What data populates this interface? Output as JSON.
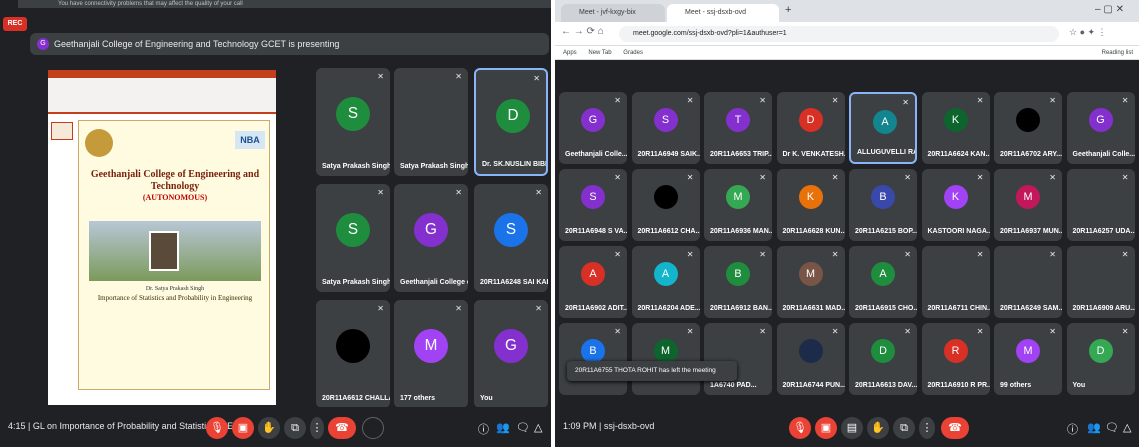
{
  "left": {
    "banner": "You have connectivity problems that may affect the quality of your call",
    "rec": "REC",
    "presenting_badge": "G",
    "presenting_text": "Geethanjali College of Engineering and Technology GCET is presenting",
    "slide": {
      "title": "Geethanjali College of Engineering and Technology",
      "autonomous": "(AUTONOMOUS)",
      "logo_right": "NBA",
      "presenter_name": "Dr. Satya Prakash Singh",
      "topic": "Importance of Statistics and Probability in Engineering"
    },
    "tiles": [
      {
        "initial": "S",
        "name": "Satya Prakash Singh",
        "color": "#1e8e3e"
      },
      {
        "initial": "",
        "name": "Satya Prakash Singh",
        "color": "#3c4043"
      },
      {
        "initial": "D",
        "name": "Dr. SK.NUSLIN BIBI GCET",
        "color": "#1e8e3e"
      },
      {
        "initial": "S",
        "name": "Satya Prakash Singh",
        "color": "#1e8e3e"
      },
      {
        "initial": "G",
        "name": "Geethanjali College of En...",
        "color": "#8430ce"
      },
      {
        "initial": "S",
        "name": "20R11A6248 SAI KARTHIK ...",
        "color": "#1a73e8"
      },
      {
        "initial": "",
        "name": "20R11A6612 CHALLA SHU...",
        "color": "#000000"
      },
      {
        "initial": "M",
        "name": "177 others",
        "color": "#a142f4"
      },
      {
        "initial": "G",
        "name": "You",
        "color": "#8430ce"
      }
    ],
    "bottom_text": "4:15 | GL on Importance of Probability and Statistics in En..."
  },
  "right": {
    "tabs": [
      "Meet - jvf-kxgy-bix",
      "Meet - ssj-dsxb-ovd"
    ],
    "url": "meet.google.com/ssj-dsxb-ovd?pli=1&authuser=1",
    "bookmarks": [
      "Apps",
      "New Tab",
      "Grades"
    ],
    "reading_list": "Reading list",
    "tiles": [
      {
        "initial": "G",
        "name": "Geethanjali Colle...",
        "color": "#8430ce"
      },
      {
        "initial": "S",
        "name": "20R11A6949 SAIK...",
        "color": "#8430ce"
      },
      {
        "initial": "T",
        "name": "20R11A6653 TRIP...",
        "color": "#8430ce"
      },
      {
        "initial": "D",
        "name": "Dr K. VENKATESH...",
        "color": "#d93025"
      },
      {
        "initial": "A",
        "name": "ALLUGUVELLI RA...",
        "color": "#12858f"
      },
      {
        "initial": "K",
        "name": "20R11A6624 KAN...",
        "color": "#0d652d"
      },
      {
        "initial": "",
        "name": "20R11A6702 ARY...",
        "color": "#000000"
      },
      {
        "initial": "G",
        "name": "Geethanjali Colle...",
        "color": "#8430ce"
      },
      {
        "initial": "S",
        "name": "20R11A6948 S VA...",
        "color": "#8430ce"
      },
      {
        "initial": "",
        "name": "20R11A6612 CHA...",
        "color": "#000000"
      },
      {
        "initial": "M",
        "name": "20R11A6936 MAN...",
        "color": "#34a853"
      },
      {
        "initial": "K",
        "name": "20R11A6628 KUN...",
        "color": "#e8710a"
      },
      {
        "initial": "B",
        "name": "20R11A6215 BOP...",
        "color": "#3949ab"
      },
      {
        "initial": "K",
        "name": "KASTOORI NAGA...",
        "color": "#a142f4"
      },
      {
        "initial": "M",
        "name": "20R11A6937 MUN...",
        "color": "#c2185b"
      },
      {
        "initial": "",
        "name": "20R11A6257 UDA...",
        "color": "#3c4043"
      },
      {
        "initial": "A",
        "name": "20R11A6902 ADIT...",
        "color": "#d93025"
      },
      {
        "initial": "A",
        "name": "20R11A6204 ADE...",
        "color": "#12b5cb"
      },
      {
        "initial": "B",
        "name": "20R11A6912 BAN...",
        "color": "#1e8e3e"
      },
      {
        "initial": "M",
        "name": "20R11A6631 MAD...",
        "color": "#795548"
      },
      {
        "initial": "A",
        "name": "20R11A6915 CHO...",
        "color": "#1e8e3e"
      },
      {
        "initial": "",
        "name": "20R11A6711 CHIN...",
        "color": "#3c4043"
      },
      {
        "initial": "",
        "name": "20R11A6249 SAM...",
        "color": "#3c4043"
      },
      {
        "initial": "",
        "name": "20R11A6909 ARU...",
        "color": "#3c4043"
      },
      {
        "initial": "B",
        "name": "",
        "color": "#1a73e8"
      },
      {
        "initial": "M",
        "name": "",
        "color": "#0d652d"
      },
      {
        "initial": "",
        "name": "1A6740 PAD...",
        "color": "#3c4043"
      },
      {
        "initial": "",
        "name": "20R11A6744 PUN...",
        "color": "#1c2b4a"
      },
      {
        "initial": "D",
        "name": "20R11A6613 DAV...",
        "color": "#1e8e3e"
      },
      {
        "initial": "R",
        "name": "20R11A6910 R PR...",
        "color": "#d93025"
      },
      {
        "initial": "M",
        "name": "99 others",
        "color": "#a142f4"
      },
      {
        "initial": "D",
        "name": "You",
        "color": "#34a853"
      }
    ],
    "toast": "20R11A6755 THOTA ROHIT has left the meeting",
    "bottom_text": "1:09 PM | ssj-dsxb-ovd"
  }
}
